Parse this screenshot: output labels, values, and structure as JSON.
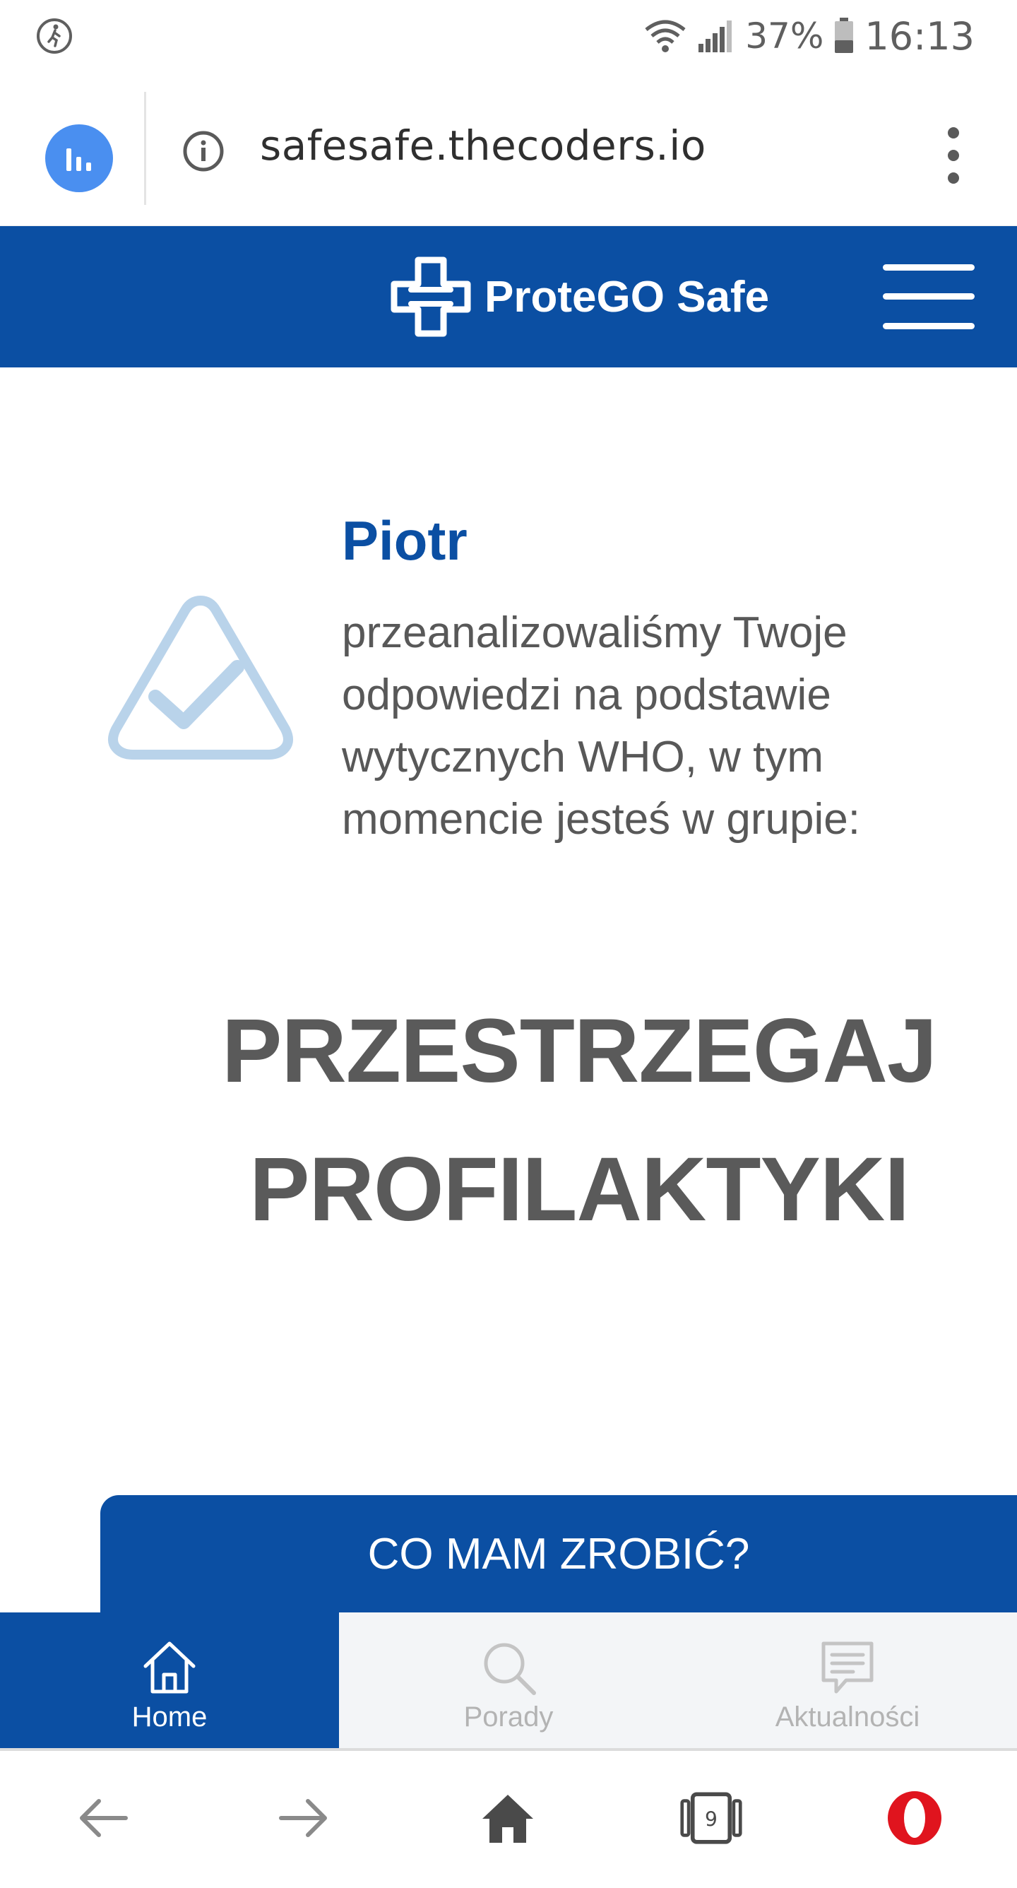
{
  "status_bar": {
    "battery_percent": "37%",
    "time": "16:13",
    "icons": [
      "walking-person-icon",
      "wifi-icon",
      "signal-icon",
      "battery-icon"
    ]
  },
  "url_bar": {
    "url": "safesafe.thecoders.io",
    "icons": [
      "stats-icon",
      "info-icon",
      "more-vert-icon"
    ]
  },
  "header": {
    "logo_text": "ProteGO Safe",
    "brand_color": "#0b4fa3",
    "icons": [
      "protego-logo-icon",
      "hamburger-menu-icon"
    ]
  },
  "result": {
    "name": "Piotr",
    "message": "przeanalizowaliśmy Twoje odpowiedzi na podstawie wytycznych WHO, w tym momencie jesteś w grupie:",
    "group_line1": "PRZESTRZEGAJ",
    "group_line2": "PROFILAKTYKI",
    "icon": "triangle-check-icon"
  },
  "cta": {
    "label": "CO MAM ZROBIĆ?"
  },
  "tabs": [
    {
      "label": "Home",
      "icon": "home-icon",
      "active": true
    },
    {
      "label": "Porady",
      "icon": "search-icon",
      "active": false
    },
    {
      "label": "Aktualności",
      "icon": "news-icon",
      "active": false
    }
  ],
  "browser_bar": {
    "tab_count": "9",
    "icons": [
      "back-arrow-icon",
      "forward-arrow-icon",
      "home-icon",
      "tabs-icon",
      "opera-logo-icon"
    ]
  }
}
